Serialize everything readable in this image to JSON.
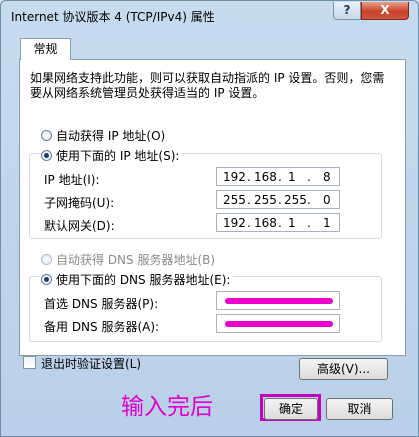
{
  "window": {
    "title": "Internet 协议版本 4 (TCP/IPv4) 属性",
    "help_label": "?",
    "close_label": "X"
  },
  "tab": {
    "label": "常规"
  },
  "description": "如果网络支持此功能，则可以获取自动指派的 IP 设置。否则，您需要从网络系统管理员处获得适当的 IP 设置。",
  "ip": {
    "auto_label": "自动获得 IP 地址(O)",
    "manual_label": "使用下面的 IP 地址(S):",
    "fields": [
      {
        "label": "IP 地址(I):",
        "octets": [
          "192",
          "168",
          "1",
          "8"
        ]
      },
      {
        "label": "子网掩码(U):",
        "octets": [
          "255",
          "255",
          "255",
          "0"
        ]
      },
      {
        "label": "默认网关(D):",
        "octets": [
          "192",
          "168",
          "1",
          "1"
        ]
      }
    ],
    "selected": "manual"
  },
  "dns": {
    "auto_label": "自动获得 DNS 服务器地址(B)",
    "manual_label": "使用下面的 DNS 服务器地址(E):",
    "preferred_label": "首选 DNS 服务器(P):",
    "alternate_label": "备用 DNS 服务器(A):",
    "selected": "manual",
    "redaction_color": "#ee00cc"
  },
  "validate_label": "退出时验证设置(L)",
  "advanced_label": "高级(V)...",
  "ok_label": "确定",
  "cancel_label": "取消",
  "annotation": {
    "text": "输入完后",
    "color": "#e000d0"
  }
}
